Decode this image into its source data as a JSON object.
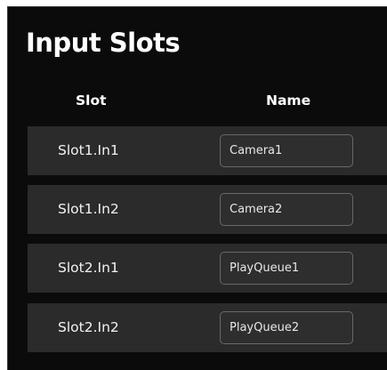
{
  "title": "Input Slots",
  "columns": {
    "slot": "Slot",
    "name": "Name"
  },
  "rows": [
    {
      "slot": "Slot1.In1",
      "name": "Camera1"
    },
    {
      "slot": "Slot1.In2",
      "name": "Camera2"
    },
    {
      "slot": "Slot2.In1",
      "name": "PlayQueue1"
    },
    {
      "slot": "Slot2.In2",
      "name": "PlayQueue2"
    }
  ],
  "colors": {
    "background": "#0b0b0b",
    "row_background": "#2b2b2b",
    "input_border": "#686868",
    "text": "#ffffff"
  }
}
